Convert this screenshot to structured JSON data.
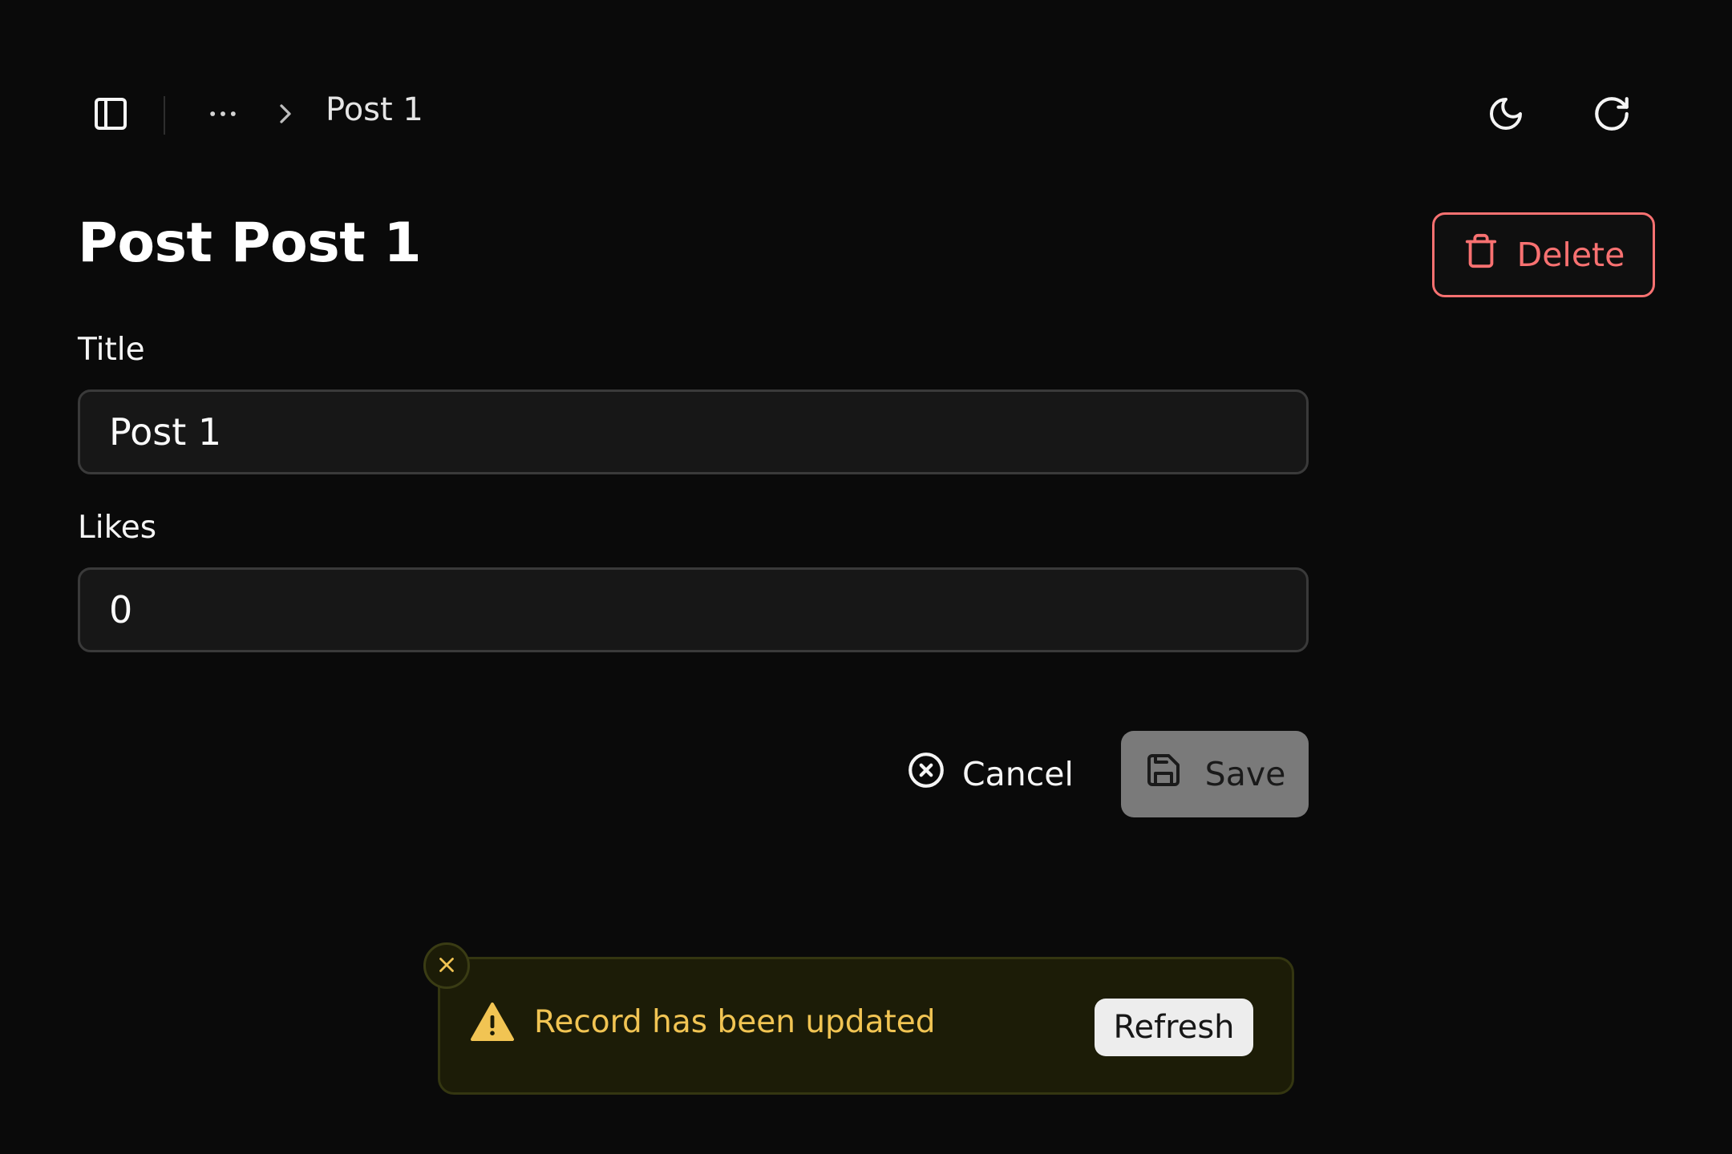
{
  "header": {
    "sidebar_toggle_icon": "panel-left-icon",
    "breadcrumb": {
      "overflow_icon": "ellipsis-icon",
      "separator_icon": "chevron-right-icon",
      "current": "Post 1"
    },
    "theme_toggle_icon": "moon-icon",
    "refresh_icon": "refresh-icon"
  },
  "page": {
    "title": "Post Post 1",
    "delete_label": "Delete",
    "delete_icon": "trash-icon"
  },
  "form": {
    "fields": [
      {
        "label": "Title",
        "value": "Post 1"
      },
      {
        "label": "Likes",
        "value": "0"
      }
    ],
    "cancel_label": "Cancel",
    "cancel_icon": "circle-x-icon",
    "save_label": "Save",
    "save_icon": "save-icon"
  },
  "toast": {
    "message": "Record has been updated",
    "action_label": "Refresh",
    "icon": "warning-triangle-icon",
    "close_icon": "close-icon"
  },
  "colors": {
    "background": "#0a0a0a",
    "destructive": "#f87171",
    "warning": "#f1c453",
    "toast_bg": "#1c1c07"
  }
}
